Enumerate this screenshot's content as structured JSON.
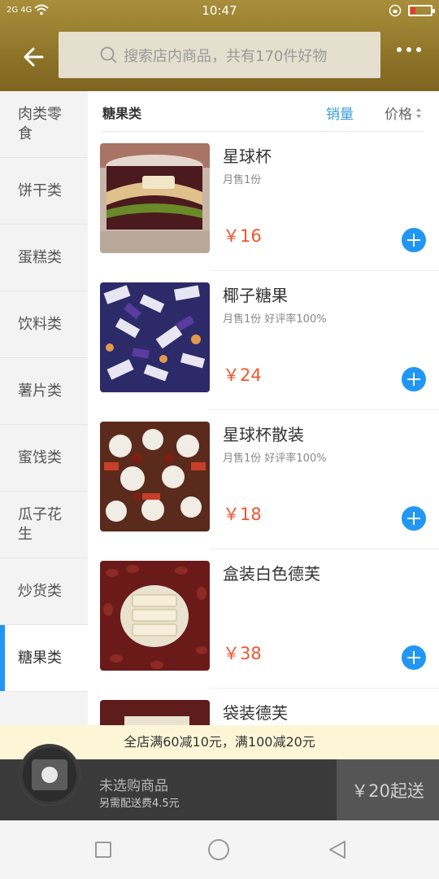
{
  "status_bar": {
    "signal_left": "2G 4G",
    "time": "10:47",
    "icons": [
      "signal-icon",
      "wifi-icon",
      "lock-rotation-icon",
      "battery-icon"
    ]
  },
  "header": {
    "search_placeholder": "搜索店内商品，共有170件好物",
    "icons": [
      "back-arrow-icon",
      "search-icon",
      "more-icon"
    ]
  },
  "sidebar": {
    "items": [
      {
        "label": "肉类零食"
      },
      {
        "label": "饼干类"
      },
      {
        "label": "蛋糕类"
      },
      {
        "label": "饮料类"
      },
      {
        "label": "薯片类"
      },
      {
        "label": "蜜饯类"
      },
      {
        "label": "瓜子花生"
      },
      {
        "label": "炒货类"
      },
      {
        "label": "糖果类",
        "active": true
      }
    ]
  },
  "main": {
    "category_title": "糖果类",
    "sort_sales": "销量",
    "sort_price": "价格",
    "products": [
      {
        "name": "星球杯",
        "meta": "月售1份",
        "price": "￥16"
      },
      {
        "name": "椰子糖果",
        "meta": "月售1份 好评率100%",
        "price": "￥24"
      },
      {
        "name": "星球杯散装",
        "meta": "月售1份 好评率100%",
        "price": "￥18"
      },
      {
        "name": "盒装白色德芙",
        "meta": "",
        "price": "￥38"
      },
      {
        "name": "袋装德芙",
        "meta": "",
        "price": ""
      }
    ]
  },
  "promo": {
    "text": "全店满60减10元，满100减20元"
  },
  "cart": {
    "empty_text": "未选购商品",
    "delivery_fee": "另需配送费4.5元",
    "checkout_label": "￥20起送"
  },
  "colors": {
    "accent_blue": "#2196f3",
    "price_red": "#f0562e",
    "header_gold": "#9d8534"
  }
}
